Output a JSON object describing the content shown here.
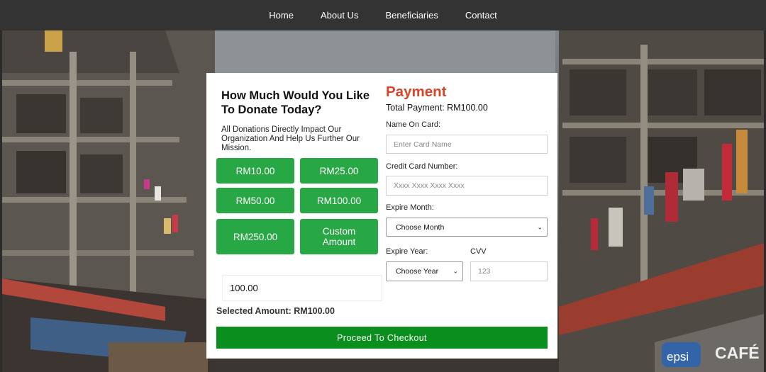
{
  "nav": {
    "items": [
      "Home",
      "About Us",
      "Beneficiaries",
      "Contact"
    ]
  },
  "donate": {
    "title": "How Much Would You Like To Donate Today?",
    "subtitle": "All Donations Directly Impact Our Organization And Help Us Further Our Mission.",
    "amounts": [
      "RM10.00",
      "RM25.00",
      "RM50.00",
      "RM100.00",
      "RM250.00",
      "Custom Amount"
    ],
    "amount_value": "100.00",
    "selected_label": "Selected Amount: RM100.00"
  },
  "payment": {
    "title": "Payment",
    "total": "Total Payment: RM100.00",
    "name_label": "Name On Card:",
    "name_placeholder": "Enter Card Name",
    "card_label": "Credit Card Number:",
    "card_placeholder": "Xxxx Xxxx Xxxx Xxxx",
    "month_label": "Expire Month:",
    "month_selected": "Choose Month",
    "year_label": "Expire Year:",
    "year_selected": "Choose Year",
    "cvv_label": "CVV",
    "cvv_placeholder": "123",
    "checkout_label": "Proceed To Checkout"
  },
  "colors": {
    "nav_bg": "#333333",
    "button_green": "#28a745",
    "checkout_green": "#0a8f1f",
    "payment_title": "#d6452b"
  },
  "icons": {
    "select_arrow": "chevron-down-icon"
  }
}
